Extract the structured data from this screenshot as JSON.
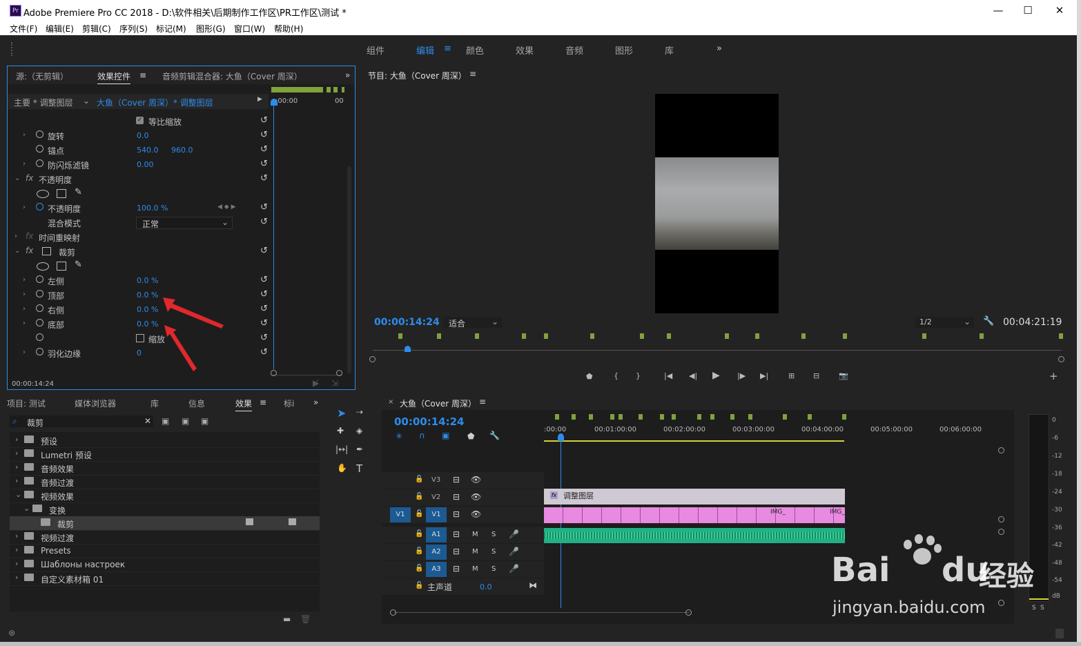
{
  "window": {
    "title": "Adobe Premiere Pro CC 2018 - D:\\软件相关\\后期制作工作区\\PR工作区\\测试 *",
    "app_icon": "Pr"
  },
  "menu": [
    "文件(F)",
    "编辑(E)",
    "剪辑(C)",
    "序列(S)",
    "标记(M)",
    "图形(G)",
    "窗口(W)",
    "帮助(H)"
  ],
  "workspaces": [
    "组件",
    "编辑",
    "颜色",
    "效果",
    "音频",
    "图形",
    "库"
  ],
  "workspace_more": "»",
  "effect_panel": {
    "tabs": [
      "源:（无剪辑）",
      "效果控件",
      "音频剪辑混合器: 大鱼（Cover 周深）"
    ],
    "master_label": "主要 * 调整图层",
    "clip_label": "大鱼（Cover 周深）* 调整图层",
    "mini_time_start": ":00:00",
    "mini_time_end": "00",
    "uniform_scale": "等比缩放",
    "rotation": {
      "label": "旋转",
      "value": "0.0"
    },
    "anchor": {
      "label": "锚点",
      "x": "540.0",
      "y": "960.0"
    },
    "flicker": {
      "label": "防闪烁滤镜",
      "value": "0.00"
    },
    "opacity_group": "不透明度",
    "opacity": {
      "label": "不透明度",
      "value": "100.0 %"
    },
    "blend": {
      "label": "混合模式",
      "value": "正常"
    },
    "time_remap": "时间重映射",
    "crop_group": "裁剪",
    "crop_left": {
      "label": "左侧",
      "value": "0.0 %"
    },
    "crop_top": {
      "label": "顶部",
      "value": "0.0 %"
    },
    "crop_right": {
      "label": "右侧",
      "value": "0.0 %"
    },
    "crop_bottom": {
      "label": "底部",
      "value": "0.0 %"
    },
    "zoom": "缩放",
    "feather": {
      "label": "羽化边缘",
      "value": "0"
    },
    "timecode": "00:00:14:24"
  },
  "program_monitor": {
    "title": "节目: 大鱼（Cover 周深）",
    "timecode": "00:00:14:24",
    "fit": "适合",
    "resolution": "1/2",
    "duration": "00:04:21:19"
  },
  "project_panel": {
    "tabs": [
      "项目: 测试",
      "媒体浏览器",
      "库",
      "信息",
      "效果",
      "标i"
    ],
    "search_value": "裁剪",
    "items": [
      {
        "label": "预设",
        "indent": 0,
        "expanded": false
      },
      {
        "label": "Lumetri 预设",
        "indent": 0,
        "expanded": false
      },
      {
        "label": "音频效果",
        "indent": 0,
        "expanded": false
      },
      {
        "label": "音频过渡",
        "indent": 0,
        "expanded": false
      },
      {
        "label": "视频效果",
        "indent": 0,
        "expanded": true
      },
      {
        "label": "变换",
        "indent": 1,
        "expanded": true
      },
      {
        "label": "裁剪",
        "indent": 2,
        "expanded": false
      },
      {
        "label": "视频过渡",
        "indent": 0,
        "expanded": false
      },
      {
        "label": "Presets",
        "indent": 0,
        "expanded": false
      },
      {
        "label": "Шаблоны настроек",
        "indent": 0,
        "expanded": false
      },
      {
        "label": "自定义素材箱 01",
        "indent": 0,
        "expanded": false
      }
    ]
  },
  "timeline": {
    "title": "大鱼（Cover 周深）",
    "timecode": "00:00:14:24",
    "ruler": [
      ":00:00",
      "00:01:00:00",
      "00:02:00:00",
      "00:03:00:00",
      "00:04:00:00",
      "00:05:00:00",
      "00:06:00:00"
    ],
    "tracks": {
      "v3": "V3",
      "v2": "V2",
      "v1": "V1",
      "a1": "A1",
      "a2": "A2",
      "a3": "A3",
      "src_v1": "V1"
    },
    "master": {
      "label": "主声道",
      "value": "0.0"
    },
    "adjustment_clip": "调整图层",
    "clip_label": "IMG_",
    "mute": "M",
    "solo": "S"
  },
  "meter": {
    "labels": [
      "0",
      "-6",
      "-12",
      "-18",
      "-24",
      "-30",
      "-36",
      "-42",
      "-48",
      "-54",
      "dB"
    ],
    "solo": [
      "S",
      "S"
    ]
  },
  "watermark": {
    "brand": "Bai",
    "brand2": "du",
    "sub": "经验",
    "url": "jingyan.baidu.com"
  },
  "colors": {
    "accent": "#2d8ceb",
    "clip_pink": "#e88ae0",
    "clip_audio": "#22b085",
    "marker": "#7fa23d",
    "annotation": "#e0282d"
  }
}
